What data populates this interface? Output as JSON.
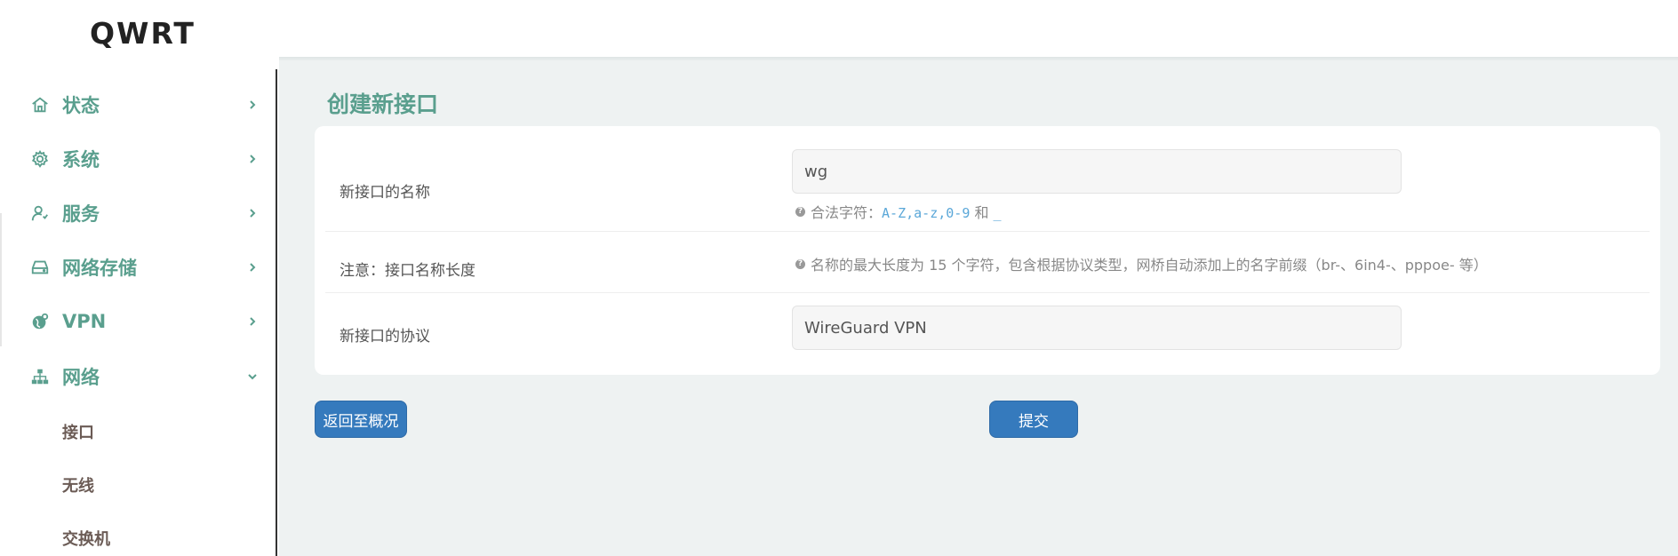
{
  "brand": "QWRT",
  "sidebar": {
    "items": [
      {
        "label": "状态",
        "icon": "home-icon",
        "chevron": "chevron-right-icon"
      },
      {
        "label": "系统",
        "icon": "gear-icon",
        "chevron": "chevron-right-icon"
      },
      {
        "label": "服务",
        "icon": "user-service-icon",
        "chevron": "chevron-right-icon"
      },
      {
        "label": "网络存储",
        "icon": "drive-icon",
        "chevron": "chevron-right-icon"
      },
      {
        "label": "VPN",
        "icon": "globe-icon",
        "chevron": "chevron-right-icon"
      },
      {
        "label": "网络",
        "icon": "network-tree-icon",
        "chevron": "chevron-down-icon"
      }
    ],
    "subitems": [
      "接口",
      "无线",
      "交换机"
    ]
  },
  "main": {
    "title": "创建新接口",
    "form": {
      "name_label": "新接口的名称",
      "name_value": "wg",
      "name_hint_prefix": "合法字符：",
      "name_hint_chars1": "A-Z",
      "name_hint_sep1": ",",
      "name_hint_chars2": "a-z",
      "name_hint_sep2": ",",
      "name_hint_chars3": "0-9",
      "name_hint_and": " 和 ",
      "name_hint_chars4": "_",
      "note_label": "注意：接口名称长度",
      "note_hint": "名称的最大长度为 15 个字符，包含根据协议类型，网桥自动添加上的名字前缀（br-、6in4-、pppoe- 等）",
      "protocol_label": "新接口的协议",
      "protocol_value": "WireGuard VPN"
    },
    "buttons": {
      "back": "返回至概况",
      "submit": "提交"
    }
  },
  "colors": {
    "accent": "#5a9f8e",
    "button": "#357abd",
    "background": "#eef2f2"
  }
}
